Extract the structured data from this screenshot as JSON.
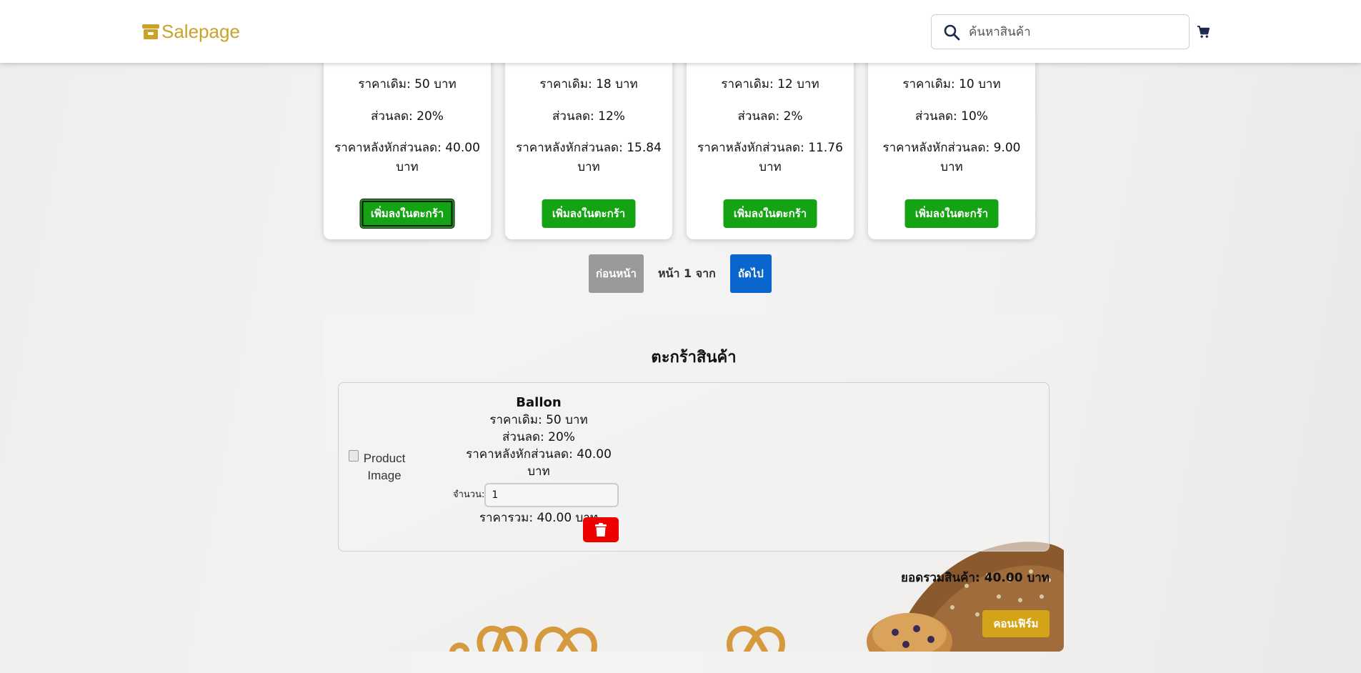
{
  "colors": {
    "brand": "#c9a227",
    "add_button": "#13a313",
    "prev_button": "#9a9a9a",
    "next_button": "#0a66cc",
    "delete_button": "#ee0000",
    "confirm_button": "#d4a418"
  },
  "header": {
    "logo_text": "Salepage",
    "logo_icon": "store-icon",
    "search_placeholder": "ค้นหาสินค้า",
    "search_icon": "search-icon",
    "cart_icon": "cart-icon"
  },
  "products": [
    {
      "price": "ราคาเดิม: 50 บาท",
      "discount": "ส่วนลด: 20%",
      "final": "ราคาหลังหักส่วนลด: 40.00 บาท",
      "button": "เพิ่มลงในตะกร้า"
    },
    {
      "price": "ราคาเดิม: 18 บาท",
      "discount": "ส่วนลด: 12%",
      "final": "ราคาหลังหักส่วนลด: 15.84 บาท",
      "button": "เพิ่มลงในตะกร้า"
    },
    {
      "price": "ราคาเดิม: 12 บาท",
      "discount": "ส่วนลด: 2%",
      "final": "ราคาหลังหักส่วนลด: 11.76 บาท",
      "button": "เพิ่มลงในตะกร้า"
    },
    {
      "price": "ราคาเดิม: 10 บาท",
      "discount": "ส่วนลด: 10%",
      "final": "ราคาหลังหักส่วนลด: 9.00 บาท",
      "button": "เพิ่มลงในตะกร้า"
    }
  ],
  "pagination": {
    "prev": "ก่อนหน้า",
    "page_text": "หน้า 1 จาก",
    "next": "ถัดไป"
  },
  "cart": {
    "title": "ตะกร้าสินค้า",
    "item": {
      "image_alt": "Product Image",
      "name": "Ballon",
      "price": "ราคาเดิม: 50 บาท",
      "discount": "ส่วนลด: 20%",
      "final": "ราคาหลังหักส่วนลด: 40.00 บาท",
      "qty_label": "จำนวน:",
      "qty_value": "1",
      "line_total": "ราคารวม: 40.00 บาท",
      "delete_icon": "trash-icon"
    },
    "grand_total": "ยอดรวมสินค้า: 40.00 บาท",
    "confirm": "คอนเฟิร์ม"
  }
}
